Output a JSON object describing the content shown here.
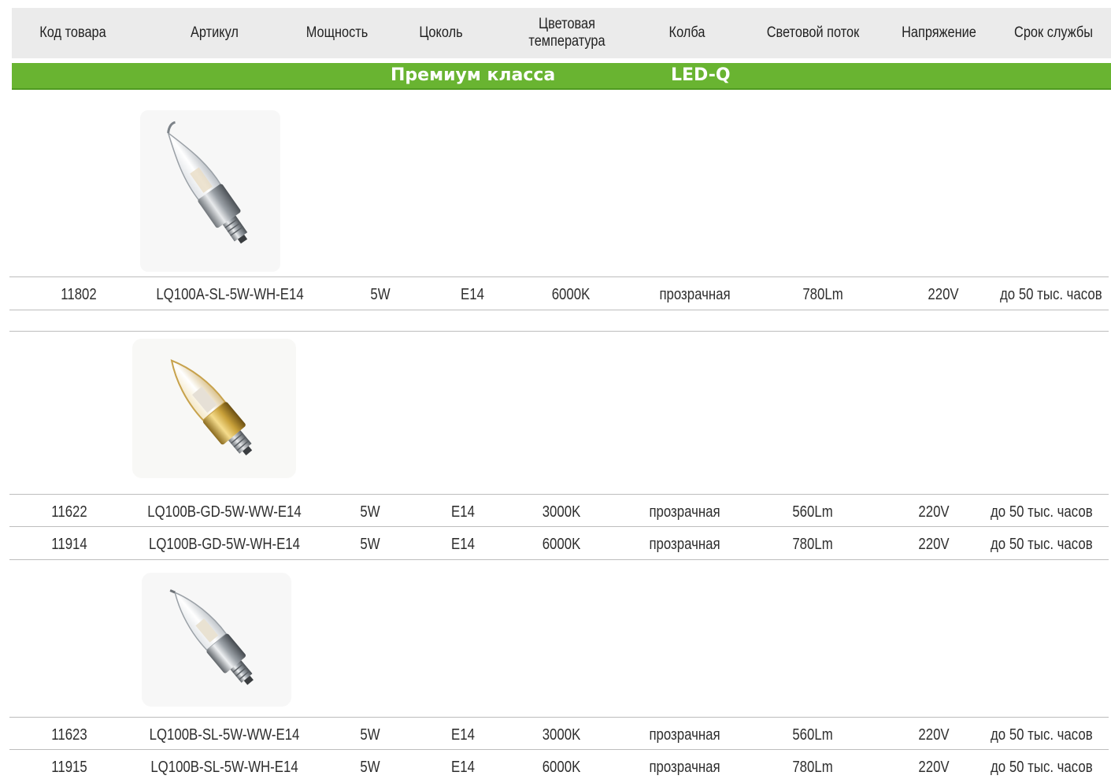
{
  "columns": {
    "code": "Код товара",
    "article": "Артикул",
    "power": "Мощность",
    "base": "Цоколь",
    "color_temp_line1": "Цветовая",
    "color_temp_line2": "температура",
    "bulb": "Колба",
    "flux": "Световой  поток",
    "voltage": "Напряжение",
    "lifetime": "Срок службы"
  },
  "section": {
    "title": "Премиум класса",
    "series": "LED-Q"
  },
  "colors": {
    "header_bg": "#ebebeb",
    "section_bg": "#69b431",
    "section_text": "#ffffff"
  },
  "groups": [
    {
      "image": "candle-bulb-flame-tip-silver",
      "rows": [
        {
          "code": "11802",
          "article": "LQ100A-SL-5W-WH-E14",
          "power": "5W",
          "base": "E14",
          "temp": "6000K",
          "bulb": "прозрачная",
          "flux": "780Lm",
          "voltage": "220V",
          "lifetime": "до 50 тыс. часов"
        }
      ]
    },
    {
      "image": "candle-bulb-gold",
      "rows": [
        {
          "code": "11622",
          "article": "LQ100B-GD-5W-WW-E14",
          "power": "5W",
          "base": "E14",
          "temp": "3000K",
          "bulb": "прозрачная",
          "flux": "560Lm",
          "voltage": "220V",
          "lifetime": "до 50 тыс. часов"
        },
        {
          "code": "11914",
          "article": "LQ100B-GD-5W-WH-E14",
          "power": "5W",
          "base": "E14",
          "temp": "6000K",
          "bulb": "прозрачная",
          "flux": "780Lm",
          "voltage": "220V",
          "lifetime": "до 50 тыс. часов"
        }
      ]
    },
    {
      "image": "candle-bulb-silver",
      "rows": [
        {
          "code": "11623",
          "article": "LQ100B-SL-5W-WW-E14",
          "power": "5W",
          "base": "E14",
          "temp": "3000K",
          "bulb": "прозрачная",
          "flux": "560Lm",
          "voltage": "220V",
          "lifetime": "до 50 тыс. часов"
        },
        {
          "code": "11915",
          "article": "LQ100B-SL-5W-WH-E14",
          "power": "5W",
          "base": "E14",
          "temp": "6000K",
          "bulb": "прозрачная",
          "flux": "780Lm",
          "voltage": "220V",
          "lifetime": "до 50 тыс. часов"
        }
      ]
    }
  ]
}
